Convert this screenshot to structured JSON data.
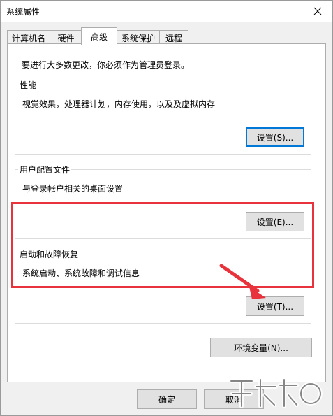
{
  "window": {
    "title": "系统属性"
  },
  "tabs": [
    {
      "label": "计算机名"
    },
    {
      "label": "硬件"
    },
    {
      "label": "高级"
    },
    {
      "label": "系统保护"
    },
    {
      "label": "远程"
    }
  ],
  "advanced": {
    "notice": "要进行大多数更改，你必须作为管理员登录。",
    "performance": {
      "title": "性能",
      "description": "视觉效果，处理器计划，内存使用，以及及虚拟内存",
      "button": "设置(S)..."
    },
    "user_profiles": {
      "title": "用户配置文件",
      "description": "与登录帐户相关的桌面设置",
      "button": "设置(E)..."
    },
    "startup_recovery": {
      "title": "启动和故障恢复",
      "description": "系统启动、系统故障和调试信息",
      "button": "设置(T)..."
    },
    "env_button": "环境变量(N)..."
  },
  "footer": {
    "ok": "确定",
    "cancel": "取消"
  },
  "annotation": {
    "highlight_color": "#e8333d"
  }
}
